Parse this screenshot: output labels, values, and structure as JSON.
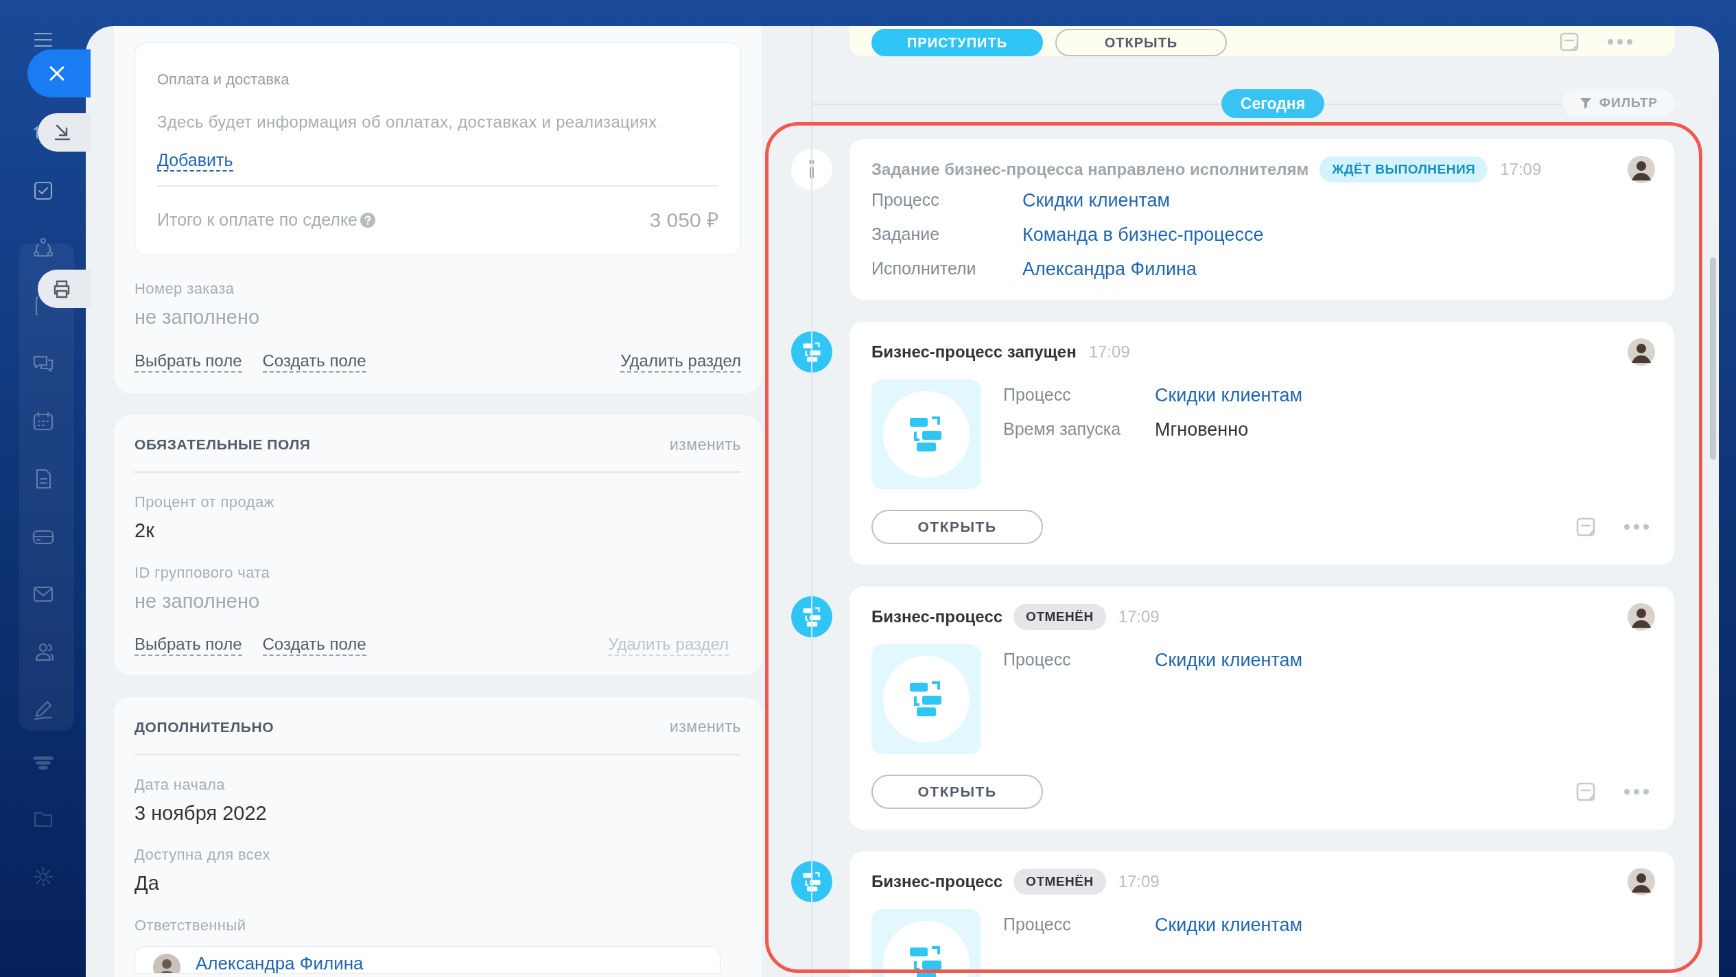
{
  "details": {
    "sections": [
      {
        "kind": "payment",
        "payment": {
          "title": "Оплата и доставка",
          "description": "Здесь будет информация об оплатах, доставках и реализациях",
          "add_link": "Добавить",
          "total_label": "Итого к оплате по сделке",
          "total_value": "3 050 ₽"
        },
        "fields": [
          {
            "kind": "text",
            "label": "Номер заказа",
            "value": "не заполнено",
            "empty": true
          }
        ],
        "links": [
          "Выбрать поле",
          "Создать поле"
        ],
        "delete_link": {
          "label": "Удалить раздел",
          "disabled": false
        }
      },
      {
        "kind": "titled",
        "title": "ОБЯЗАТЕЛЬНЫЕ ПОЛЯ",
        "edit": "изменить",
        "fields": [
          {
            "kind": "text",
            "label": "Процент от продаж",
            "value": "2к",
            "empty": false
          },
          {
            "kind": "text",
            "label": "ID группового чата",
            "value": "не заполнено",
            "empty": true
          }
        ],
        "links": [
          "Выбрать поле",
          "Создать поле"
        ],
        "delete_link": {
          "label": "Удалить раздел",
          "disabled": true
        }
      },
      {
        "kind": "titled",
        "title": "ДОПОЛНИТЕЛЬНО",
        "edit": "изменить",
        "fields": [
          {
            "kind": "text",
            "label": "Дата начала",
            "value": "3 ноября 2022",
            "empty": false
          },
          {
            "kind": "text",
            "label": "Доступна для всех",
            "value": "Да",
            "empty": false
          },
          {
            "kind": "user",
            "label": "Ответственный",
            "value": "Александра Филина",
            "empty": false
          }
        ]
      }
    ]
  },
  "timeline": {
    "pending_buttons": [
      {
        "label": "ПРИСТУПИТЬ",
        "kind": "primary"
      },
      {
        "label": "ОТКРЫТЬ",
        "kind": "outline"
      }
    ],
    "day_label": "Сегодня",
    "filter": "ФИЛЬТР",
    "highlighted": true,
    "events": [
      {
        "kind": "info",
        "title": "Задание бизнес-процесса направлено исполнителям",
        "badge": {
          "label": "ЖДЁТ ВЫПОЛНЕНИЯ",
          "kind": "waiting"
        },
        "time": "17:09",
        "rows": [
          {
            "label": "Процесс",
            "value": "Скидки клиентам",
            "link": true
          },
          {
            "label": "Задание",
            "value": "Команда в бизнес-процессе",
            "link": true
          },
          {
            "label": "Исполнители",
            "value": "Александра Филина",
            "link": true
          }
        ]
      },
      {
        "kind": "process",
        "title": "Бизнес-процесс запущен",
        "time": "17:09",
        "rows": [
          {
            "label": "Процесс",
            "value": "Скидки клиентам",
            "link": true
          },
          {
            "label": "Время запуска",
            "value": "Мгновенно",
            "link": false
          }
        ],
        "button": "ОТКРЫТЬ"
      },
      {
        "kind": "process",
        "title": "Бизнес-процесс",
        "badge": {
          "label": "ОТМЕНЁН",
          "kind": "cancelled"
        },
        "time": "17:09",
        "rows": [
          {
            "label": "Процесс",
            "value": "Скидки клиентам",
            "link": true
          }
        ],
        "button": "ОТКРЫТЬ"
      },
      {
        "kind": "process",
        "title": "Бизнес-процесс",
        "badge": {
          "label": "ОТМЕНЁН",
          "kind": "cancelled"
        },
        "time": "17:09",
        "rows": [
          {
            "label": "Процесс",
            "value": "Скидки клиентам",
            "link": true
          }
        ]
      }
    ]
  }
}
